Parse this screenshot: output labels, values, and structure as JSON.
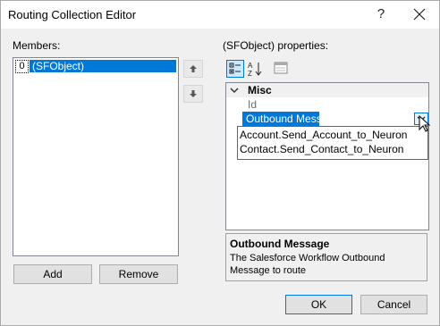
{
  "window": {
    "title": "Routing Collection Editor",
    "help_glyph": "?"
  },
  "members": {
    "label": "Members:",
    "items": [
      {
        "index": "0",
        "label": "(SFObject)",
        "selected": true
      }
    ],
    "add_label": "Add",
    "remove_label": "Remove"
  },
  "properties": {
    "label": "(SFObject) properties:",
    "category": "Misc",
    "rows": [
      {
        "name": "Id"
      },
      {
        "name": "Outbound Messa",
        "selected": true
      }
    ],
    "dropdown_options": [
      "Account.Send_Account_to_Neuron",
      "Contact.Send_Contact_to_Neuron"
    ],
    "description_title": "Outbound Message",
    "description_text": "The Salesforce Workflow Outbound Message to route"
  },
  "footer": {
    "ok_label": "OK",
    "cancel_label": "Cancel"
  },
  "colors": {
    "selection": "#0078d7",
    "window_bg": "#f0f0f0"
  },
  "icons": [
    "close-icon",
    "arrow-up-icon",
    "arrow-down-icon",
    "categorized-icon",
    "alphabetical-icon",
    "property-pages-icon",
    "chevron-down-icon",
    "dropdown-arrow-icon",
    "cursor-icon"
  ]
}
